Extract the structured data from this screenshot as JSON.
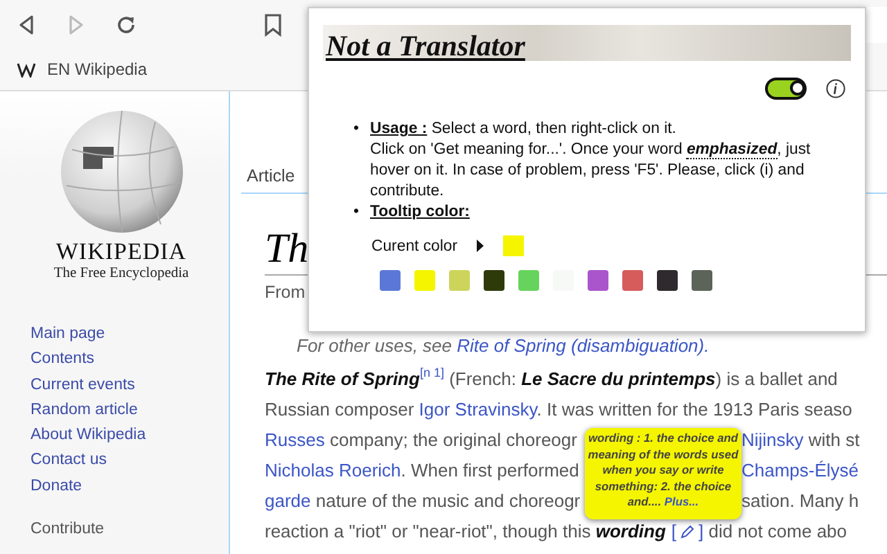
{
  "browser": {
    "nav_buttons": [
      {
        "kind": "back",
        "disabled": false
      },
      {
        "kind": "forward",
        "disabled": true
      },
      {
        "kind": "reload",
        "disabled": false
      }
    ],
    "bookmark": "EN Wikipedia"
  },
  "sidebar": {
    "logo_title": "WIKIPEDIA",
    "logo_tagline": "The Free Encyclopedia",
    "links": [
      "Main page",
      "Contents",
      "Current events",
      "Random article",
      "About Wikipedia",
      "Contact us",
      "Donate"
    ],
    "section_heading": "Contribute"
  },
  "article": {
    "tab": "Article",
    "title": "Th",
    "subtitle": "From",
    "hatnote": {
      "text": "For other uses, see ",
      "link": "Rite of Spring (disambiguation)."
    },
    "lines": [
      {
        "left": [
          {
            "kind": "bold",
            "text": "The Rite of Spring"
          },
          {
            "kind": "sup",
            "text": "[n 1]"
          },
          {
            "kind": "plain",
            "text": " (French: "
          },
          {
            "kind": "bold",
            "text": "Le Sacre du printemps"
          },
          {
            "kind": "plain",
            "text": ") is a ballet and"
          }
        ]
      },
      {
        "left": [
          {
            "kind": "plain",
            "text": "Russian composer "
          },
          {
            "kind": "link",
            "text": "Igor Stravinsky"
          },
          {
            "kind": "plain",
            "text": ". It was written for the 1913 Paris seaso"
          }
        ]
      },
      {
        "left": [
          {
            "kind": "link",
            "text": "Russes"
          },
          {
            "kind": "plain",
            "text": " company; the original choreogr"
          }
        ],
        "right": [
          {
            "kind": "link",
            "text": "Nijinsky"
          },
          {
            "kind": "plain",
            "text": " with st"
          }
        ]
      },
      {
        "left": [
          {
            "kind": "link",
            "text": "Nicholas Roerich"
          },
          {
            "kind": "plain",
            "text": ". When first performed"
          }
        ],
        "right": [
          {
            "kind": "link",
            "text": "Champs-Élysé"
          }
        ]
      },
      {
        "left": [
          {
            "kind": "link",
            "text": "garde"
          },
          {
            "kind": "plain",
            "text": " nature of the music and choreogr"
          }
        ],
        "right": [
          {
            "kind": "plain",
            "text": "sation. Many h"
          }
        ]
      },
      {
        "left": [
          {
            "kind": "plain",
            "text": "reaction a \"riot\" or \"near-riot\", though this "
          },
          {
            "kind": "bold",
            "text": "wording"
          },
          {
            "kind": "edit",
            "text": "[",
            "close": "]"
          },
          {
            "kind": "plain",
            "text": " did not come abo"
          }
        ]
      }
    ]
  },
  "popup": {
    "title": "Not a Translator",
    "enabled": true,
    "usage": {
      "bullet": "•",
      "label": "Usage :",
      "text_first_line": "Select a word, then right-click on it.",
      "text_start": "Click on 'Get meaning for...'. Once your word ",
      "emphasis": "emphasized",
      "text_end": ", just hover on it. In case of problem, press 'F5'. Please, click (i) and contribute."
    },
    "color_bullet": "•",
    "color_label": "Tooltip color:",
    "current_color_label": "Curent color",
    "current": {
      "color": "#f5f500"
    },
    "swatches": [
      {
        "color": "#5b78d6"
      },
      {
        "color": "#f5f500"
      },
      {
        "color": "#cdd45c"
      },
      {
        "color": "#2e3a0a"
      },
      {
        "color": "#66d45c"
      },
      {
        "color": "#f6f9f6"
      },
      {
        "color": "#aa55cc"
      },
      {
        "color": "#d65c5c"
      },
      {
        "color": "#2e2a2e"
      },
      {
        "color": "#5c6459"
      }
    ]
  },
  "tooltip": {
    "text": "wording : 1. the choice and meaning of the words used when you say or write something: 2. the choice and.... ",
    "more": "Plus..."
  }
}
